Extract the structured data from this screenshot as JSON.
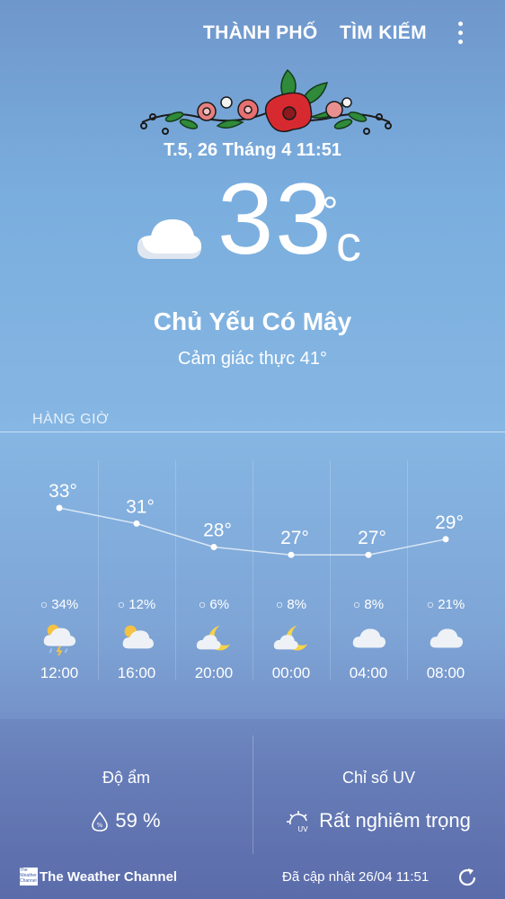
{
  "topbar": {
    "city_label": "THÀNH PHỐ",
    "search_label": "TÌM KIẾM",
    "menu_icon": "more-vert-icon"
  },
  "header": {
    "decoration": "flower-garland",
    "date_time": "T.5, 26 Tháng 4 11:51"
  },
  "current": {
    "icon": "cloud-icon",
    "temperature": "33",
    "degree": "°",
    "unit": "c",
    "condition": "Chủ Yếu Có Mây",
    "feels_like": "Cảm giác thực 41°"
  },
  "hourly": {
    "label": "HÀNG GIỜ",
    "items": [
      {
        "temp": "33°",
        "rain": "34%",
        "icon": "thunderstorm-sun-icon",
        "time": "12:00"
      },
      {
        "temp": "31°",
        "rain": "12%",
        "icon": "partly-cloudy-sun-icon",
        "time": "16:00"
      },
      {
        "temp": "28°",
        "rain": "6%",
        "icon": "partly-cloudy-moon-icon",
        "time": "20:00"
      },
      {
        "temp": "27°",
        "rain": "8%",
        "icon": "partly-cloudy-moon-icon",
        "time": "00:00"
      },
      {
        "temp": "27°",
        "rain": "8%",
        "icon": "cloud-icon",
        "time": "04:00"
      },
      {
        "temp": "29°",
        "rain": "21%",
        "icon": "cloud-icon",
        "time": "08:00"
      }
    ]
  },
  "chart_data": {
    "type": "line",
    "categories": [
      "12:00",
      "16:00",
      "20:00",
      "00:00",
      "04:00",
      "08:00"
    ],
    "series": [
      {
        "values": [
          33,
          31,
          28,
          27,
          27,
          29
        ]
      }
    ]
  },
  "details": {
    "humidity": {
      "label": "Độ ẩm",
      "value": "59 %",
      "icon": "humidity-icon"
    },
    "uv": {
      "label": "Chỉ số UV",
      "value": "Rất nghiêm trọng",
      "icon": "uv-sun-icon"
    }
  },
  "footer": {
    "provider_logo_text": "The Weather Channel",
    "provider": "The Weather Channel",
    "updated": "Đã cập nhật  26/04  11:51",
    "refresh_icon": "refresh-icon"
  }
}
